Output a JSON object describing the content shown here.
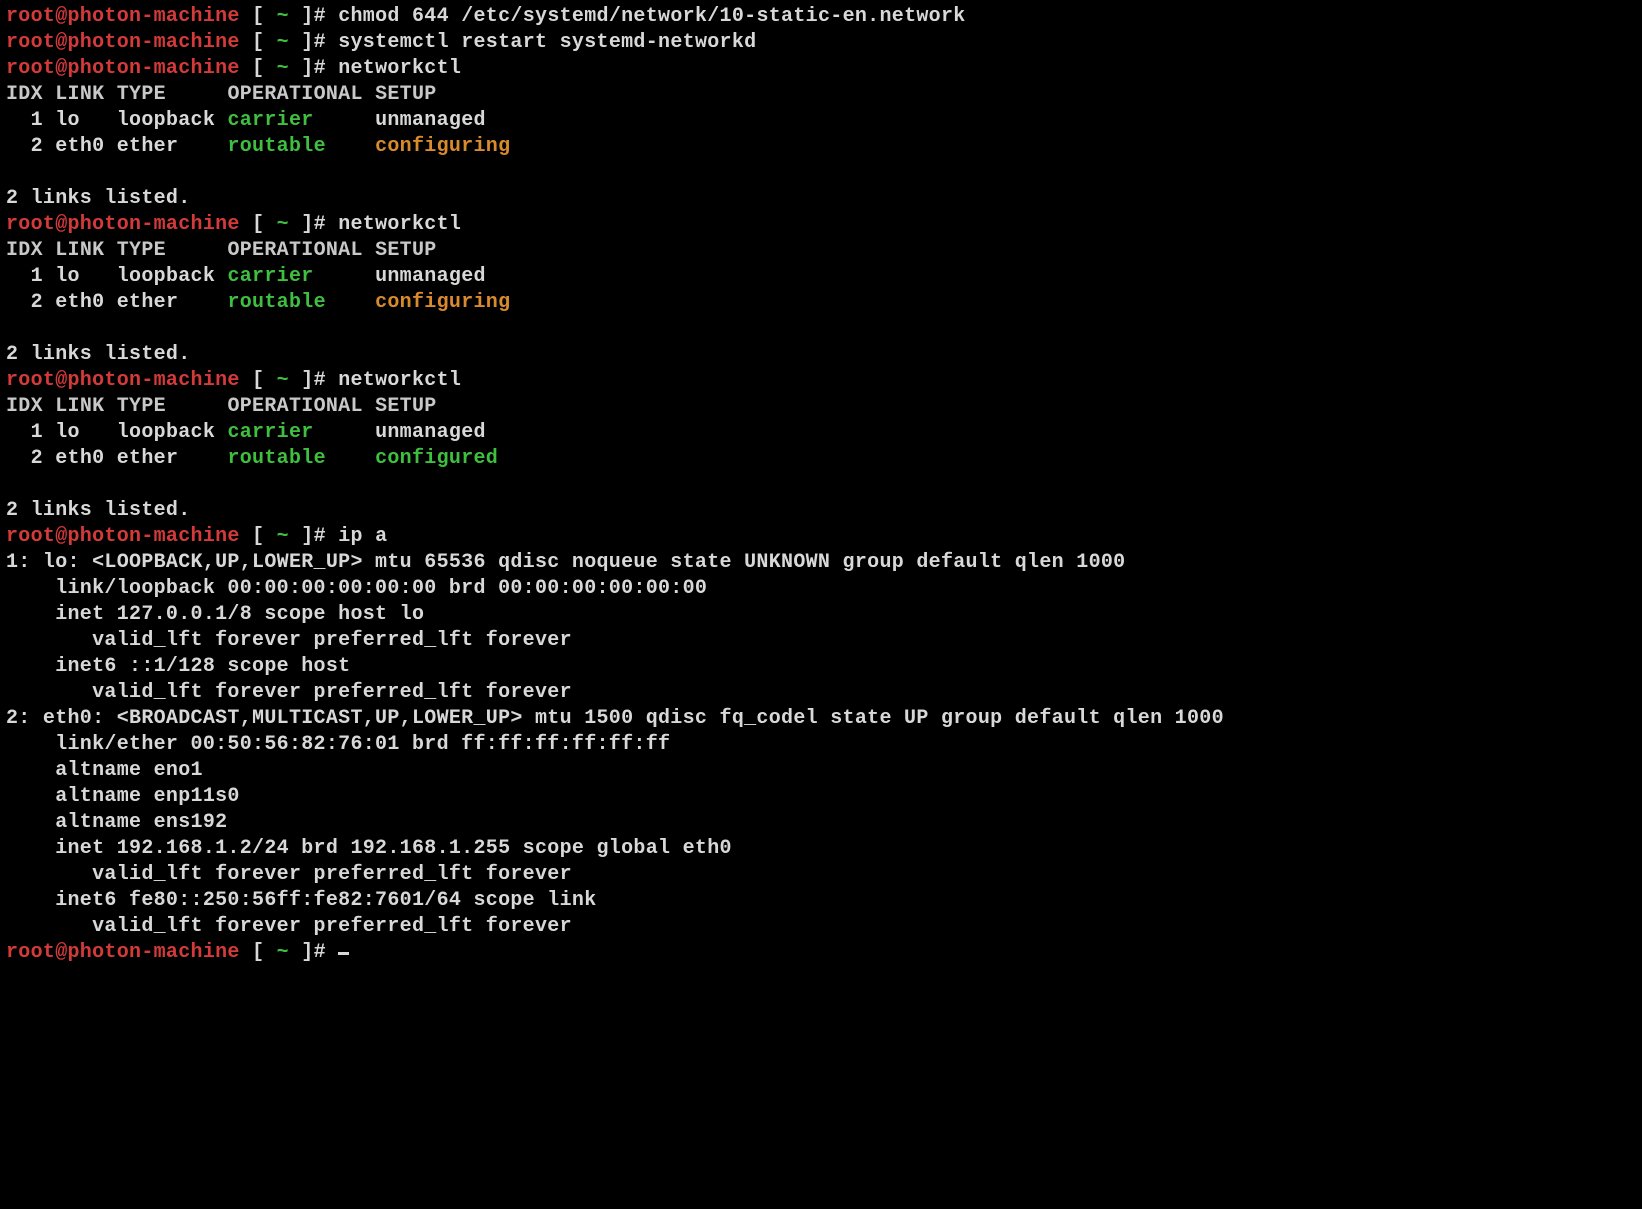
{
  "prompt": {
    "user_host": "root@photon-machine",
    "bracket_open": " [ ",
    "tilde": "~",
    "bracket_close": " ]# "
  },
  "commands": {
    "chmod": "chmod 644 /etc/systemd/network/10-static-en.network",
    "restart": "systemctl restart systemd-networkd",
    "networkctl": "networkctl",
    "ipa": "ip a"
  },
  "networkctl_header": {
    "idx": "IDX",
    "link": "LINK",
    "type": "TYPE",
    "operational": "OPERATIONAL",
    "setup": "SETUP"
  },
  "networkctl_runs": [
    {
      "rows": [
        {
          "idx": "  1",
          "link": "lo  ",
          "type": "loopback",
          "operational": "carrier  ",
          "op_class": "green",
          "setup": "unmanaged",
          "setup_class": "white"
        },
        {
          "idx": "  2",
          "link": "eth0",
          "type": "ether   ",
          "operational": "routable ",
          "op_class": "green",
          "setup": "configuring",
          "setup_class": "orange"
        }
      ],
      "footer": "2 links listed."
    },
    {
      "rows": [
        {
          "idx": "  1",
          "link": "lo  ",
          "type": "loopback",
          "operational": "carrier  ",
          "op_class": "green",
          "setup": "unmanaged",
          "setup_class": "white"
        },
        {
          "idx": "  2",
          "link": "eth0",
          "type": "ether   ",
          "operational": "routable ",
          "op_class": "green",
          "setup": "configuring",
          "setup_class": "orange"
        }
      ],
      "footer": "2 links listed."
    },
    {
      "rows": [
        {
          "idx": "  1",
          "link": "lo  ",
          "type": "loopback",
          "operational": "carrier  ",
          "op_class": "green",
          "setup": "unmanaged",
          "setup_class": "white"
        },
        {
          "idx": "  2",
          "link": "eth0",
          "type": "ether   ",
          "operational": "routable ",
          "op_class": "green",
          "setup": "configured",
          "setup_class": "green"
        }
      ],
      "footer": "2 links listed."
    }
  ],
  "ip_a_output": [
    "1: lo: <LOOPBACK,UP,LOWER_UP> mtu 65536 qdisc noqueue state UNKNOWN group default qlen 1000",
    "    link/loopback 00:00:00:00:00:00 brd 00:00:00:00:00:00",
    "    inet 127.0.0.1/8 scope host lo",
    "       valid_lft forever preferred_lft forever",
    "    inet6 ::1/128 scope host",
    "       valid_lft forever preferred_lft forever",
    "2: eth0: <BROADCAST,MULTICAST,UP,LOWER_UP> mtu 1500 qdisc fq_codel state UP group default qlen 1000",
    "    link/ether 00:50:56:82:76:01 brd ff:ff:ff:ff:ff:ff",
    "    altname eno1",
    "    altname enp11s0",
    "    altname ens192",
    "    inet 192.168.1.2/24 brd 192.168.1.255 scope global eth0",
    "       valid_lft forever preferred_lft forever",
    "    inet6 fe80::250:56ff:fe82:7601/64 scope link",
    "       valid_lft forever preferred_lft forever"
  ]
}
